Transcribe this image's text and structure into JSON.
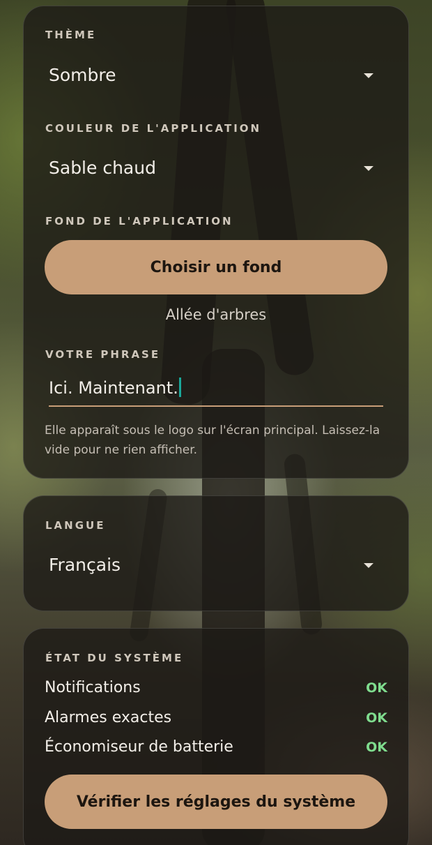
{
  "colors": {
    "accent": "#c89e78",
    "ok": "#7fdc8e",
    "card_bg": "rgba(28,25,22,0.78)"
  },
  "appearance": {
    "theme_label": "THÈME",
    "theme_value": "Sombre",
    "color_label": "COULEUR DE L'APPLICATION",
    "color_value": "Sable chaud",
    "background_label": "FOND DE L'APPLICATION",
    "background_button": "Choisir un fond",
    "background_current": "Allée d'arbres",
    "phrase_label": "VOTRE PHRASE",
    "phrase_value": "Ici. Maintenant.",
    "phrase_help": "Elle apparaît sous le logo sur l'écran principal. Laissez-la vide pour ne rien afficher."
  },
  "language": {
    "label": "LANGUE",
    "value": "Français"
  },
  "system": {
    "label": "ÉTAT DU SYSTÈME",
    "rows": [
      {
        "name": "Notifications",
        "status": "OK"
      },
      {
        "name": "Alarmes exactes",
        "status": "OK"
      },
      {
        "name": "Économiseur de batterie",
        "status": "OK"
      }
    ],
    "check_button": "Vérifier les réglages du système"
  }
}
